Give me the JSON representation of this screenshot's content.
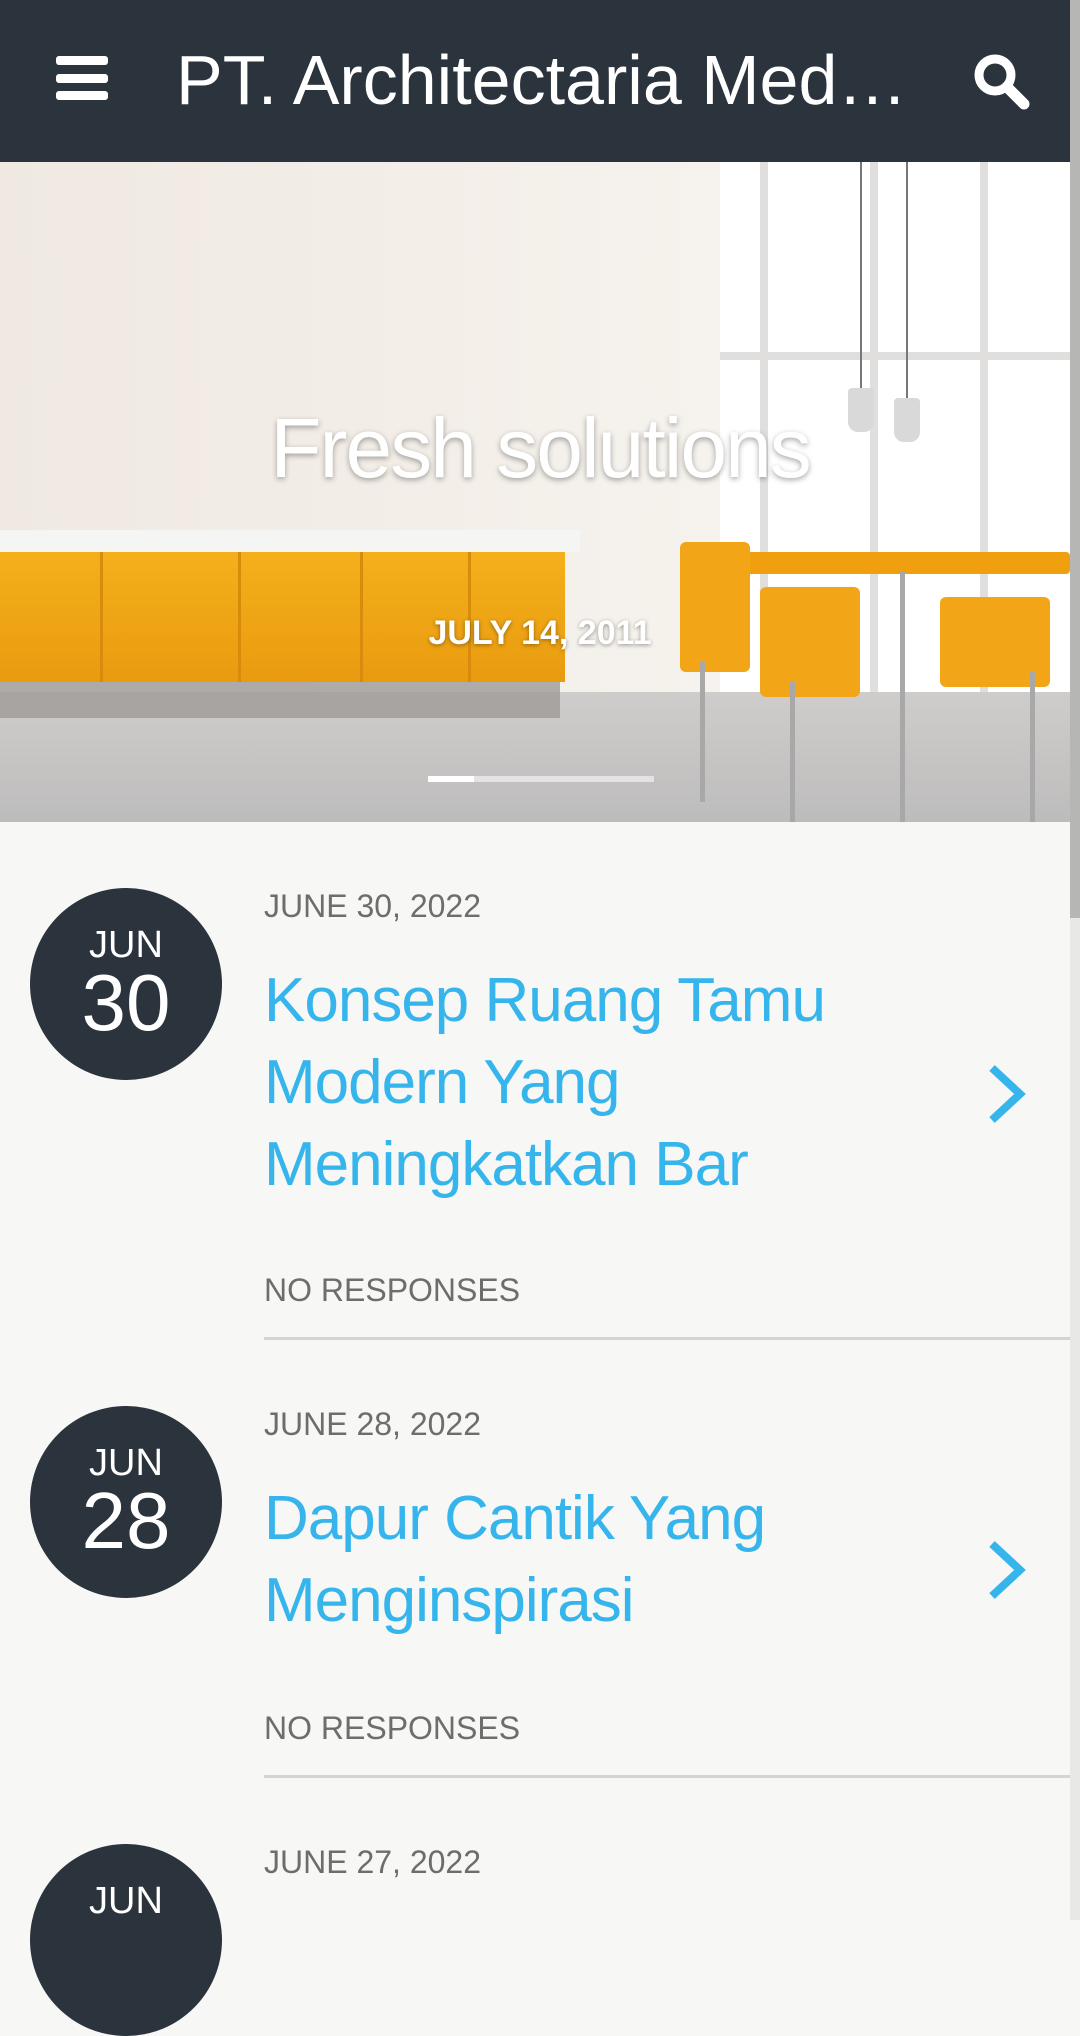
{
  "header": {
    "title": "PT. Architectaria Medi…",
    "menu_icon": "hamburger-menu-icon",
    "search_icon": "search-icon"
  },
  "hero": {
    "title": "Fresh solutions",
    "date": "JULY 14, 2011"
  },
  "posts": [
    {
      "badge_month": "JUN",
      "badge_day": "30",
      "date": "JUNE 30, 2022",
      "title": "Konsep Ruang Tamu Modern Yang Meningkatkan Bar",
      "responses": "NO RESPONSES"
    },
    {
      "badge_month": "JUN",
      "badge_day": "28",
      "date": "JUNE 28, 2022",
      "title": "Dapur Cantik Yang Menginspirasi",
      "responses": "NO RESPONSES"
    },
    {
      "badge_month": "JUN",
      "badge_day": "",
      "date": "JUNE 27, 2022",
      "title": "",
      "responses": ""
    }
  ],
  "colors": {
    "header_bg": "#2b333d",
    "accent": "#35b5ec",
    "page_bg": "#f7f7f5"
  }
}
